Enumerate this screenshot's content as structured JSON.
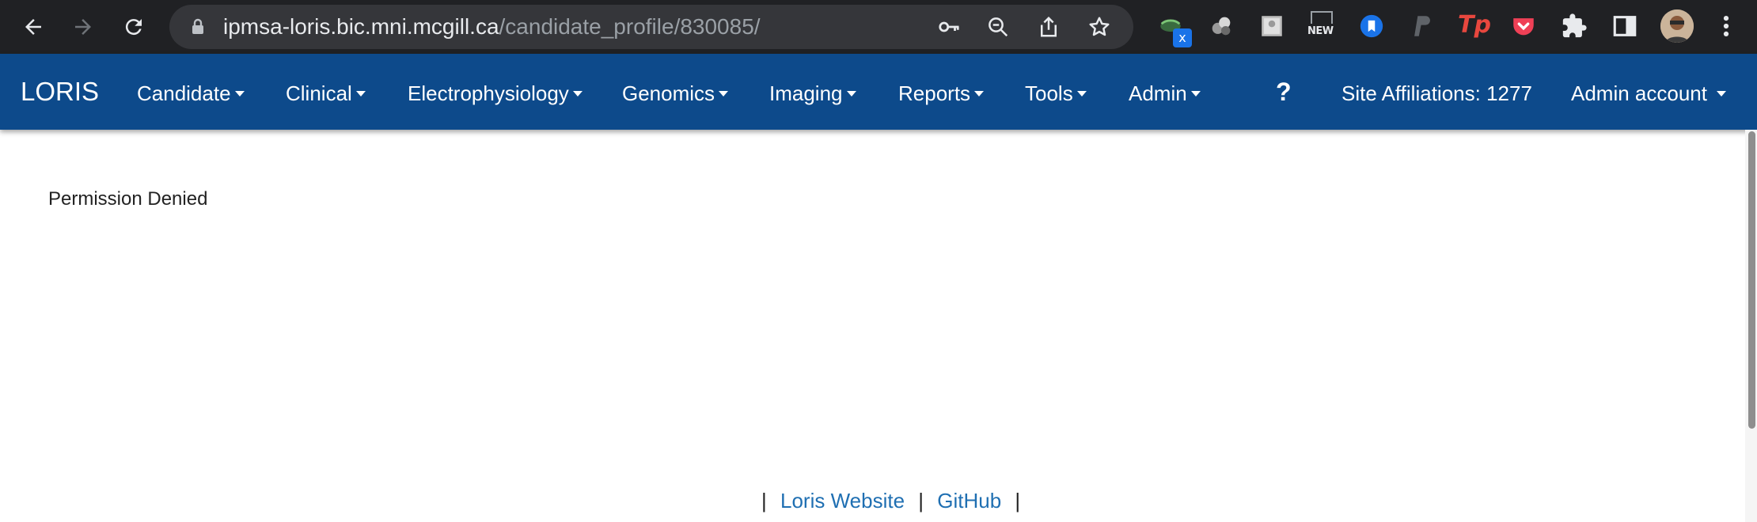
{
  "browser": {
    "url_host": "ipmsa-loris.bic.mni.mcgill.ca",
    "url_path": "/candidate_profile/830085/",
    "toolbar_icons": [
      "back-icon",
      "forward-icon",
      "reload-icon",
      "lock-icon",
      "key-icon",
      "zoom-out-icon",
      "share-icon",
      "star-icon"
    ],
    "extensions": [
      "ext-x-icon",
      "ext-spheres-icon",
      "ext-image-icon",
      "ext-new-icon",
      "ext-bookmark-icon",
      "ext-paypal-icon",
      "ext-tp-icon",
      "pocket-icon",
      "puzzle-icon",
      "sidebar-icon",
      "avatar",
      "kebab-menu-icon"
    ],
    "ext_badge": "x",
    "new_badge": "NEW",
    "tp_label": "Tp"
  },
  "navbar": {
    "brand": "LORIS",
    "menus": [
      "Candidate",
      "Clinical",
      "Electrophysiology",
      "Genomics",
      "Imaging",
      "Reports",
      "Tools",
      "Admin"
    ],
    "help": "?",
    "site_affiliations": "Site Affiliations: 1277",
    "user_menu": "Admin account"
  },
  "content": {
    "message": "Permission Denied"
  },
  "footer": {
    "separator": "|",
    "links": [
      "Loris Website",
      "GitHub"
    ]
  },
  "colors": {
    "chrome_bar": "#202124",
    "navbar": "#0d4a8b",
    "link": "#1f6fb2"
  }
}
